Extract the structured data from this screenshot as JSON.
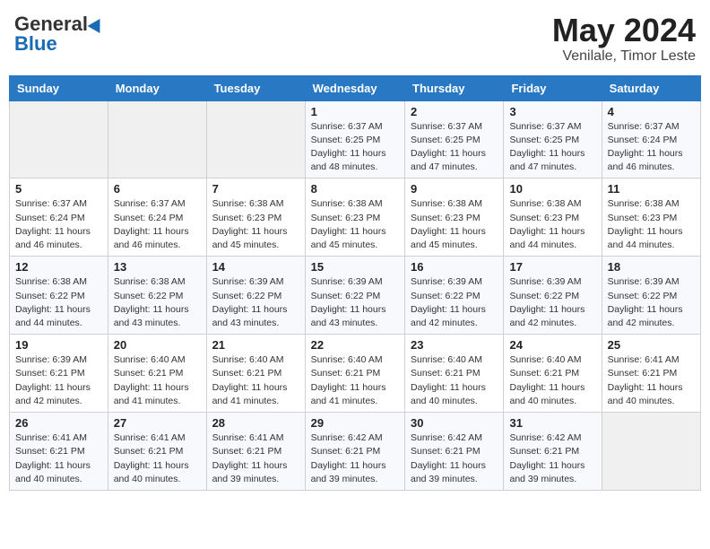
{
  "header": {
    "logo_general": "General",
    "logo_blue": "Blue",
    "title": "May 2024",
    "subtitle": "Venilale, Timor Leste"
  },
  "days_of_week": [
    "Sunday",
    "Monday",
    "Tuesday",
    "Wednesday",
    "Thursday",
    "Friday",
    "Saturday"
  ],
  "weeks": [
    [
      {
        "day": "",
        "info": ""
      },
      {
        "day": "",
        "info": ""
      },
      {
        "day": "",
        "info": ""
      },
      {
        "day": "1",
        "info": "Sunrise: 6:37 AM\nSunset: 6:25 PM\nDaylight: 11 hours\nand 48 minutes."
      },
      {
        "day": "2",
        "info": "Sunrise: 6:37 AM\nSunset: 6:25 PM\nDaylight: 11 hours\nand 47 minutes."
      },
      {
        "day": "3",
        "info": "Sunrise: 6:37 AM\nSunset: 6:25 PM\nDaylight: 11 hours\nand 47 minutes."
      },
      {
        "day": "4",
        "info": "Sunrise: 6:37 AM\nSunset: 6:24 PM\nDaylight: 11 hours\nand 46 minutes."
      }
    ],
    [
      {
        "day": "5",
        "info": "Sunrise: 6:37 AM\nSunset: 6:24 PM\nDaylight: 11 hours\nand 46 minutes."
      },
      {
        "day": "6",
        "info": "Sunrise: 6:37 AM\nSunset: 6:24 PM\nDaylight: 11 hours\nand 46 minutes."
      },
      {
        "day": "7",
        "info": "Sunrise: 6:38 AM\nSunset: 6:23 PM\nDaylight: 11 hours\nand 45 minutes."
      },
      {
        "day": "8",
        "info": "Sunrise: 6:38 AM\nSunset: 6:23 PM\nDaylight: 11 hours\nand 45 minutes."
      },
      {
        "day": "9",
        "info": "Sunrise: 6:38 AM\nSunset: 6:23 PM\nDaylight: 11 hours\nand 45 minutes."
      },
      {
        "day": "10",
        "info": "Sunrise: 6:38 AM\nSunset: 6:23 PM\nDaylight: 11 hours\nand 44 minutes."
      },
      {
        "day": "11",
        "info": "Sunrise: 6:38 AM\nSunset: 6:23 PM\nDaylight: 11 hours\nand 44 minutes."
      }
    ],
    [
      {
        "day": "12",
        "info": "Sunrise: 6:38 AM\nSunset: 6:22 PM\nDaylight: 11 hours\nand 44 minutes."
      },
      {
        "day": "13",
        "info": "Sunrise: 6:38 AM\nSunset: 6:22 PM\nDaylight: 11 hours\nand 43 minutes."
      },
      {
        "day": "14",
        "info": "Sunrise: 6:39 AM\nSunset: 6:22 PM\nDaylight: 11 hours\nand 43 minutes."
      },
      {
        "day": "15",
        "info": "Sunrise: 6:39 AM\nSunset: 6:22 PM\nDaylight: 11 hours\nand 43 minutes."
      },
      {
        "day": "16",
        "info": "Sunrise: 6:39 AM\nSunset: 6:22 PM\nDaylight: 11 hours\nand 42 minutes."
      },
      {
        "day": "17",
        "info": "Sunrise: 6:39 AM\nSunset: 6:22 PM\nDaylight: 11 hours\nand 42 minutes."
      },
      {
        "day": "18",
        "info": "Sunrise: 6:39 AM\nSunset: 6:22 PM\nDaylight: 11 hours\nand 42 minutes."
      }
    ],
    [
      {
        "day": "19",
        "info": "Sunrise: 6:39 AM\nSunset: 6:21 PM\nDaylight: 11 hours\nand 42 minutes."
      },
      {
        "day": "20",
        "info": "Sunrise: 6:40 AM\nSunset: 6:21 PM\nDaylight: 11 hours\nand 41 minutes."
      },
      {
        "day": "21",
        "info": "Sunrise: 6:40 AM\nSunset: 6:21 PM\nDaylight: 11 hours\nand 41 minutes."
      },
      {
        "day": "22",
        "info": "Sunrise: 6:40 AM\nSunset: 6:21 PM\nDaylight: 11 hours\nand 41 minutes."
      },
      {
        "day": "23",
        "info": "Sunrise: 6:40 AM\nSunset: 6:21 PM\nDaylight: 11 hours\nand 40 minutes."
      },
      {
        "day": "24",
        "info": "Sunrise: 6:40 AM\nSunset: 6:21 PM\nDaylight: 11 hours\nand 40 minutes."
      },
      {
        "day": "25",
        "info": "Sunrise: 6:41 AM\nSunset: 6:21 PM\nDaylight: 11 hours\nand 40 minutes."
      }
    ],
    [
      {
        "day": "26",
        "info": "Sunrise: 6:41 AM\nSunset: 6:21 PM\nDaylight: 11 hours\nand 40 minutes."
      },
      {
        "day": "27",
        "info": "Sunrise: 6:41 AM\nSunset: 6:21 PM\nDaylight: 11 hours\nand 40 minutes."
      },
      {
        "day": "28",
        "info": "Sunrise: 6:41 AM\nSunset: 6:21 PM\nDaylight: 11 hours\nand 39 minutes."
      },
      {
        "day": "29",
        "info": "Sunrise: 6:42 AM\nSunset: 6:21 PM\nDaylight: 11 hours\nand 39 minutes."
      },
      {
        "day": "30",
        "info": "Sunrise: 6:42 AM\nSunset: 6:21 PM\nDaylight: 11 hours\nand 39 minutes."
      },
      {
        "day": "31",
        "info": "Sunrise: 6:42 AM\nSunset: 6:21 PM\nDaylight: 11 hours\nand 39 minutes."
      },
      {
        "day": "",
        "info": ""
      }
    ]
  ]
}
